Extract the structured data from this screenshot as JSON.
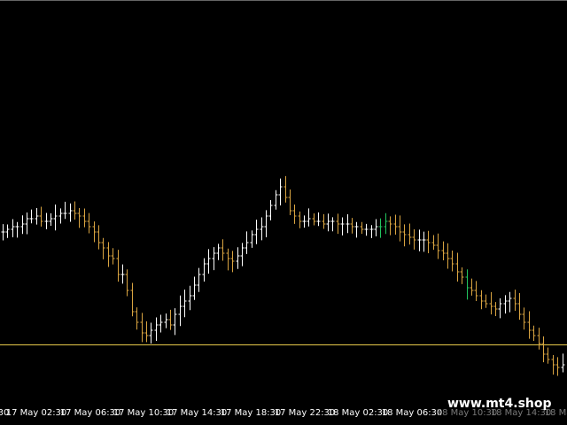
{
  "app": "MetaTrader chart",
  "colors": {
    "background": "#000000",
    "bar_up": "#ffffff",
    "bar_down": "#d9a441",
    "bar_special": "#22c55e",
    "price_line": "#e6c84a",
    "axis_text": "#ffffff"
  },
  "watermark": "www.mt4.shop",
  "time_axis": {
    "labels": [
      "17 May 02:30",
      "17 May 06:30",
      "17 May 10:30",
      "17 May 14:30",
      "17 May 18:30",
      "17 May 22:30",
      "18 May 02:30",
      "18 May 06:30",
      "18 May 10:30",
      "18 May 14:30"
    ],
    "partial_left": "30",
    "partial_right": "18 Ma"
  },
  "chart_data": {
    "type": "ohlc",
    "ylim": [
      0,
      100
    ],
    "horizontal_line": 13.5,
    "series": [
      {
        "name": "price",
        "values": [
          56,
          57,
          58,
          58,
          59,
          61,
          61,
          62,
          60,
          60,
          61,
          62,
          63,
          63,
          64,
          63,
          62,
          60,
          58,
          56,
          52,
          50,
          47,
          46,
          40,
          40,
          34,
          26,
          22,
          18,
          17,
          19,
          21,
          22,
          23,
          21,
          25,
          28,
          30,
          32,
          36,
          40,
          44,
          46,
          48,
          50,
          48,
          46,
          45,
          47,
          50,
          52,
          55,
          57,
          58,
          62,
          66,
          70,
          73,
          69,
          64,
          62,
          60,
          60,
          61,
          60,
          60,
          59,
          60,
          60,
          59,
          59,
          59,
          58,
          58,
          57,
          57,
          57,
          58,
          58,
          60,
          59,
          58,
          56,
          55,
          54,
          53,
          53,
          53,
          52,
          51,
          49,
          48,
          46,
          44,
          41,
          39,
          35,
          34,
          32,
          30,
          29,
          28,
          27,
          29,
          30,
          31,
          29,
          25,
          22,
          19,
          17,
          14,
          10,
          8,
          6,
          5,
          6
        ]
      }
    ]
  }
}
